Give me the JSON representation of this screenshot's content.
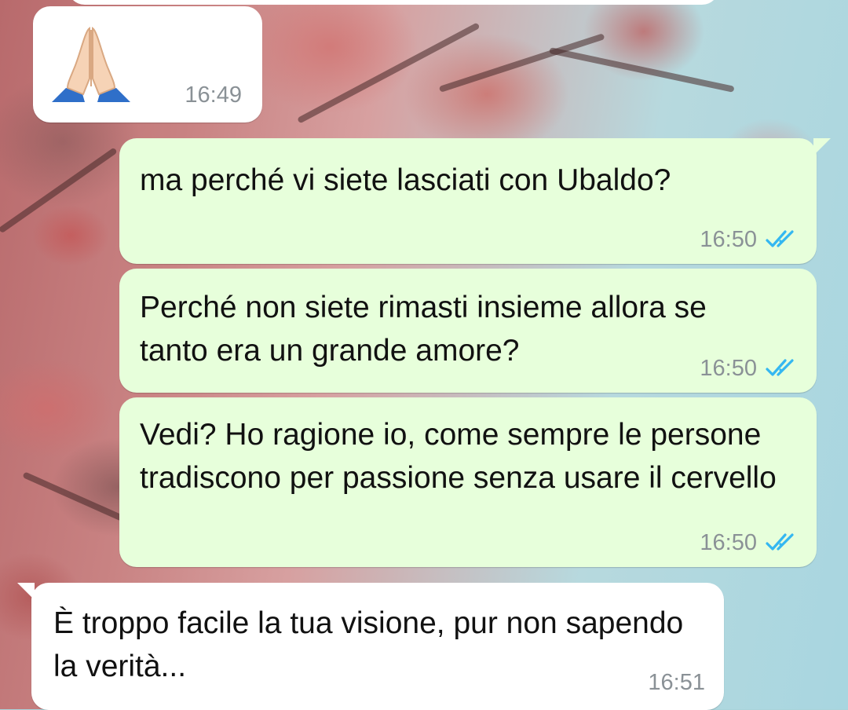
{
  "colors": {
    "incoming_bubble": "#ffffff",
    "outgoing_bubble": "#e7ffdb",
    "read_ticks": "#34b7f1",
    "timestamp": "#8a9196"
  },
  "messages": [
    {
      "direction": "in",
      "emoji": "folded-hands",
      "time": "16:49"
    },
    {
      "direction": "out",
      "text": "ma perché vi siete lasciati con Ubaldo?",
      "time": "16:50",
      "status": "read"
    },
    {
      "direction": "out",
      "text": "Perché non siete rimasti insieme allora se tanto era un grande amore?",
      "time": "16:50",
      "status": "read"
    },
    {
      "direction": "out",
      "text": "Vedi? Ho ragione io, come sempre le persone tradiscono per passione senza usare il cervello",
      "time": "16:50",
      "status": "read"
    },
    {
      "direction": "in",
      "text": "È troppo facile la tua visione, pur non sapendo la verità...",
      "time": "16:51"
    }
  ]
}
